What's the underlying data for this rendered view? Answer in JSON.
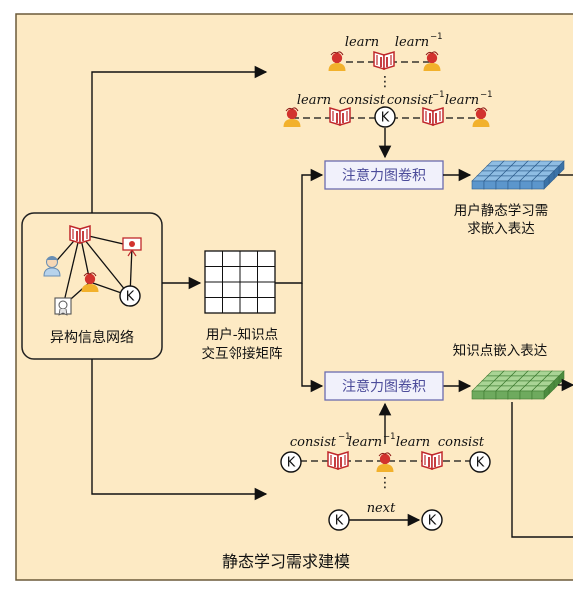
{
  "diagram": {
    "caption": "静态学习需求建模",
    "hetero_network_label": "异构信息网络",
    "matrix_label_line1": "用户-知识点",
    "matrix_label_line2": "交互邻接矩阵",
    "gcn_top_label": "注意力图卷积",
    "gcn_bottom_label": "注意力图卷积",
    "user_embed_line1": "用户静态学习需",
    "user_embed_line2": "求嵌入表达",
    "kp_embed_label": "知识点嵌入表达",
    "k_symbol": "K",
    "ellipsis": "⋮",
    "top_path1": {
      "rel1": "learn",
      "rel2": "learn",
      "sup2": "−1"
    },
    "top_path2": {
      "rel1": "learn",
      "rel2": "consist",
      "rel3": "consist",
      "sup3": "−1",
      "rel4": "learn",
      "sup4": "−1"
    },
    "bottom_path1": {
      "rel1": "consist",
      "sup1": "−1",
      "rel2": "learn",
      "sup2": "−1",
      "rel3": "learn",
      "rel4": "consist"
    },
    "bottom_path2": {
      "rel": "next"
    },
    "colors": {
      "panel_fill": "#fdeac4",
      "panel_border": "#6b5a3a",
      "gcn_fill": "#f1f1fb",
      "gcn_border": "#6c6cae",
      "gcn_text": "#4c4c9a",
      "book_red": "#c0282b",
      "user_red": "#d2322e",
      "user_body": "#f2b12c",
      "blue_embed": "#5c96cc",
      "green_embed": "#6eaa5e"
    },
    "icons": [
      "user-icon",
      "book-icon",
      "knowledge-node-icon",
      "teacher-icon",
      "presentation-icon",
      "certificate-icon"
    ]
  }
}
